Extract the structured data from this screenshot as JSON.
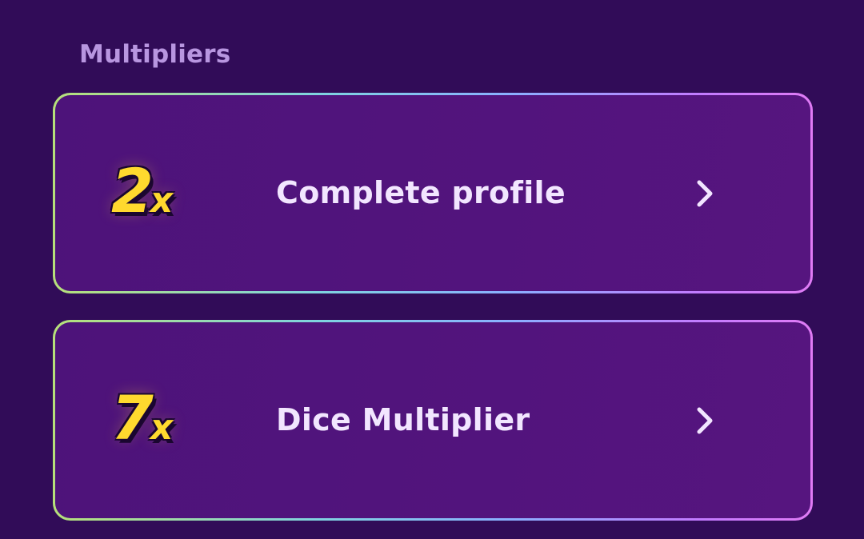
{
  "section": {
    "title": "Multipliers"
  },
  "cards": [
    {
      "multiplier_value": "2",
      "multiplier_suffix": "x",
      "label": "Complete profile",
      "icon": "chevron-right-icon"
    },
    {
      "multiplier_value": "7",
      "multiplier_suffix": "x",
      "label": "Dice Multiplier",
      "icon": "chevron-right-icon"
    }
  ],
  "colors": {
    "background": "#310c58",
    "card": "#54157f",
    "title": "#b896e0",
    "label": "#f2e6ff",
    "multiplier": "#ffd92e",
    "border_start": "#b7e07a",
    "border_end": "#e07bf5"
  }
}
